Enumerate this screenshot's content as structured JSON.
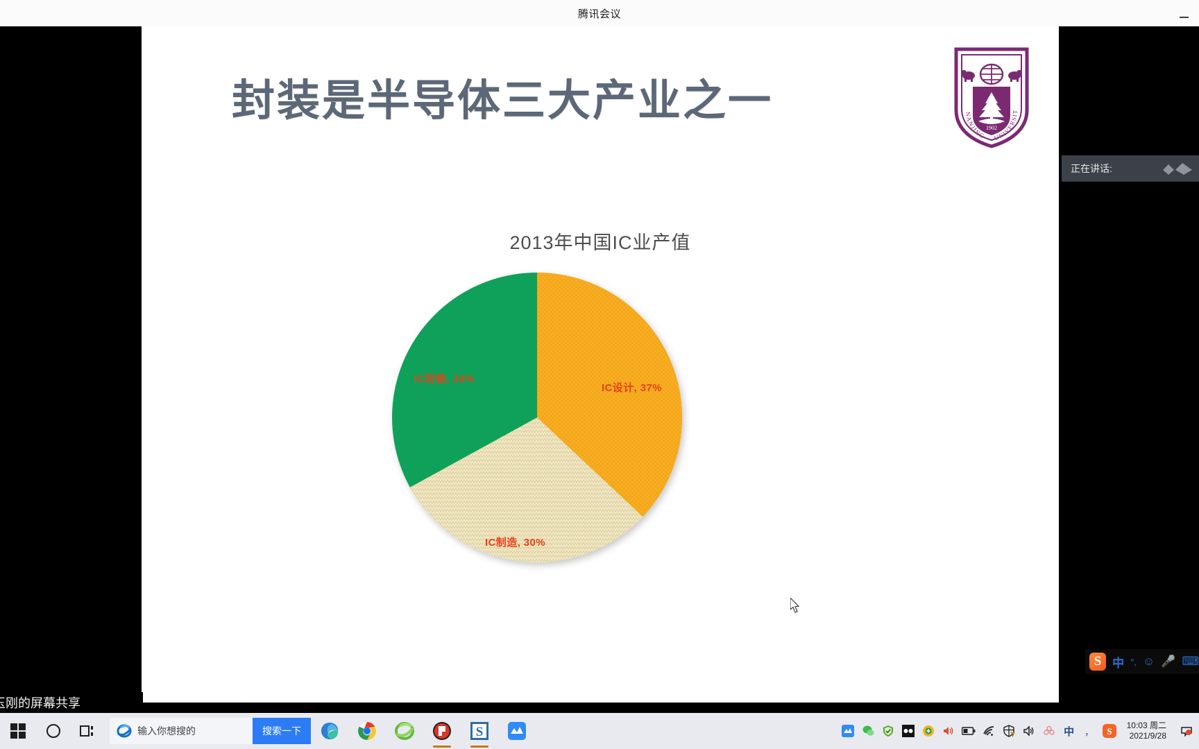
{
  "window": {
    "title": "腾讯会议",
    "minimize_label": "最小化"
  },
  "share_bar": {
    "text": "玉刚的屏幕共享"
  },
  "slide": {
    "title": "封装是半导体三大产业之一",
    "title_color": "#5c6878",
    "logo": {
      "name": "nanjing-university-logo",
      "line_top": "NANJING",
      "line_bottom": "UNIVERSITY",
      "year": "1902",
      "color": "#7b2a72"
    }
  },
  "chart_data": {
    "type": "pie",
    "title": "2013年中国IC业产值",
    "categories": [
      "IC设计",
      "IC制造",
      "IC封装"
    ],
    "values": [
      37,
      30,
      33
    ],
    "labels": [
      "IC设计, 37%",
      "IC制造, 30%",
      "IC封装, 33%"
    ],
    "colors": [
      "#f5a818",
      "#eee3bc",
      "#0fa15a"
    ],
    "label_color": "#e8411b",
    "legend": "none",
    "grid": false,
    "units": "%"
  },
  "toast": {
    "label": "正在讲话:",
    "icon": "speaking-waves-icon",
    "background": "#3c4149"
  },
  "sogou_bar": {
    "logo": "S",
    "mode": "中",
    "punct": "°,",
    "emoji": "☺",
    "mic": "🎤",
    "keyboard": "⌨"
  },
  "taskbar": {
    "start_icon": "windows-start-icon",
    "cortana_icon": "cortana-circle-icon",
    "taskview_icon": "task-view-icon",
    "search": {
      "icon": "internet-explorer-icon",
      "placeholder": "输入你想搜的",
      "value": "",
      "button_label": "搜索一下",
      "button_color": "#2b7cf5"
    },
    "apps": [
      {
        "name": "microsoft-edge-icon",
        "label": "Microsoft Edge",
        "running": false
      },
      {
        "name": "google-chrome-icon",
        "label": "Google Chrome",
        "running": false
      },
      {
        "name": "internet-explorer-icon",
        "label": "Internet Explorer",
        "running": false
      },
      {
        "name": "wps-office-icon",
        "label": "WPS Office",
        "running": true
      },
      {
        "name": "sogou-input-icon",
        "label": "搜狗输入法",
        "running": true
      },
      {
        "name": "tencent-meeting-icon",
        "label": "腾讯会议",
        "running": true
      }
    ],
    "tray": [
      {
        "name": "tencent-meeting-tray-icon",
        "glyph": "M"
      },
      {
        "name": "wechat-tray-icon",
        "glyph": "W"
      },
      {
        "name": "security-shield-tray-icon",
        "glyph": "S"
      },
      {
        "name": "screen-capture-tray-icon",
        "glyph": "D"
      },
      {
        "name": "update-tray-icon",
        "glyph": "+"
      },
      {
        "name": "volume-speaker-tray-icon",
        "glyph": "🔊"
      },
      {
        "name": "battery-tray-icon",
        "glyph": "B"
      },
      {
        "name": "wifi-tray-icon",
        "glyph": "W"
      },
      {
        "name": "action-center-shield-icon",
        "glyph": "!"
      },
      {
        "name": "volume-tray-icon",
        "glyph": "🔊"
      },
      {
        "name": "flower-tray-icon",
        "glyph": "F"
      },
      {
        "name": "ime-chinese-icon",
        "glyph": "中"
      },
      {
        "name": "ime-punct-icon",
        "glyph": "，"
      },
      {
        "name": "sogou-tray-icon",
        "glyph": "S"
      }
    ],
    "clock": {
      "time": "10:03 周二",
      "date": "2021/9/28"
    }
  }
}
